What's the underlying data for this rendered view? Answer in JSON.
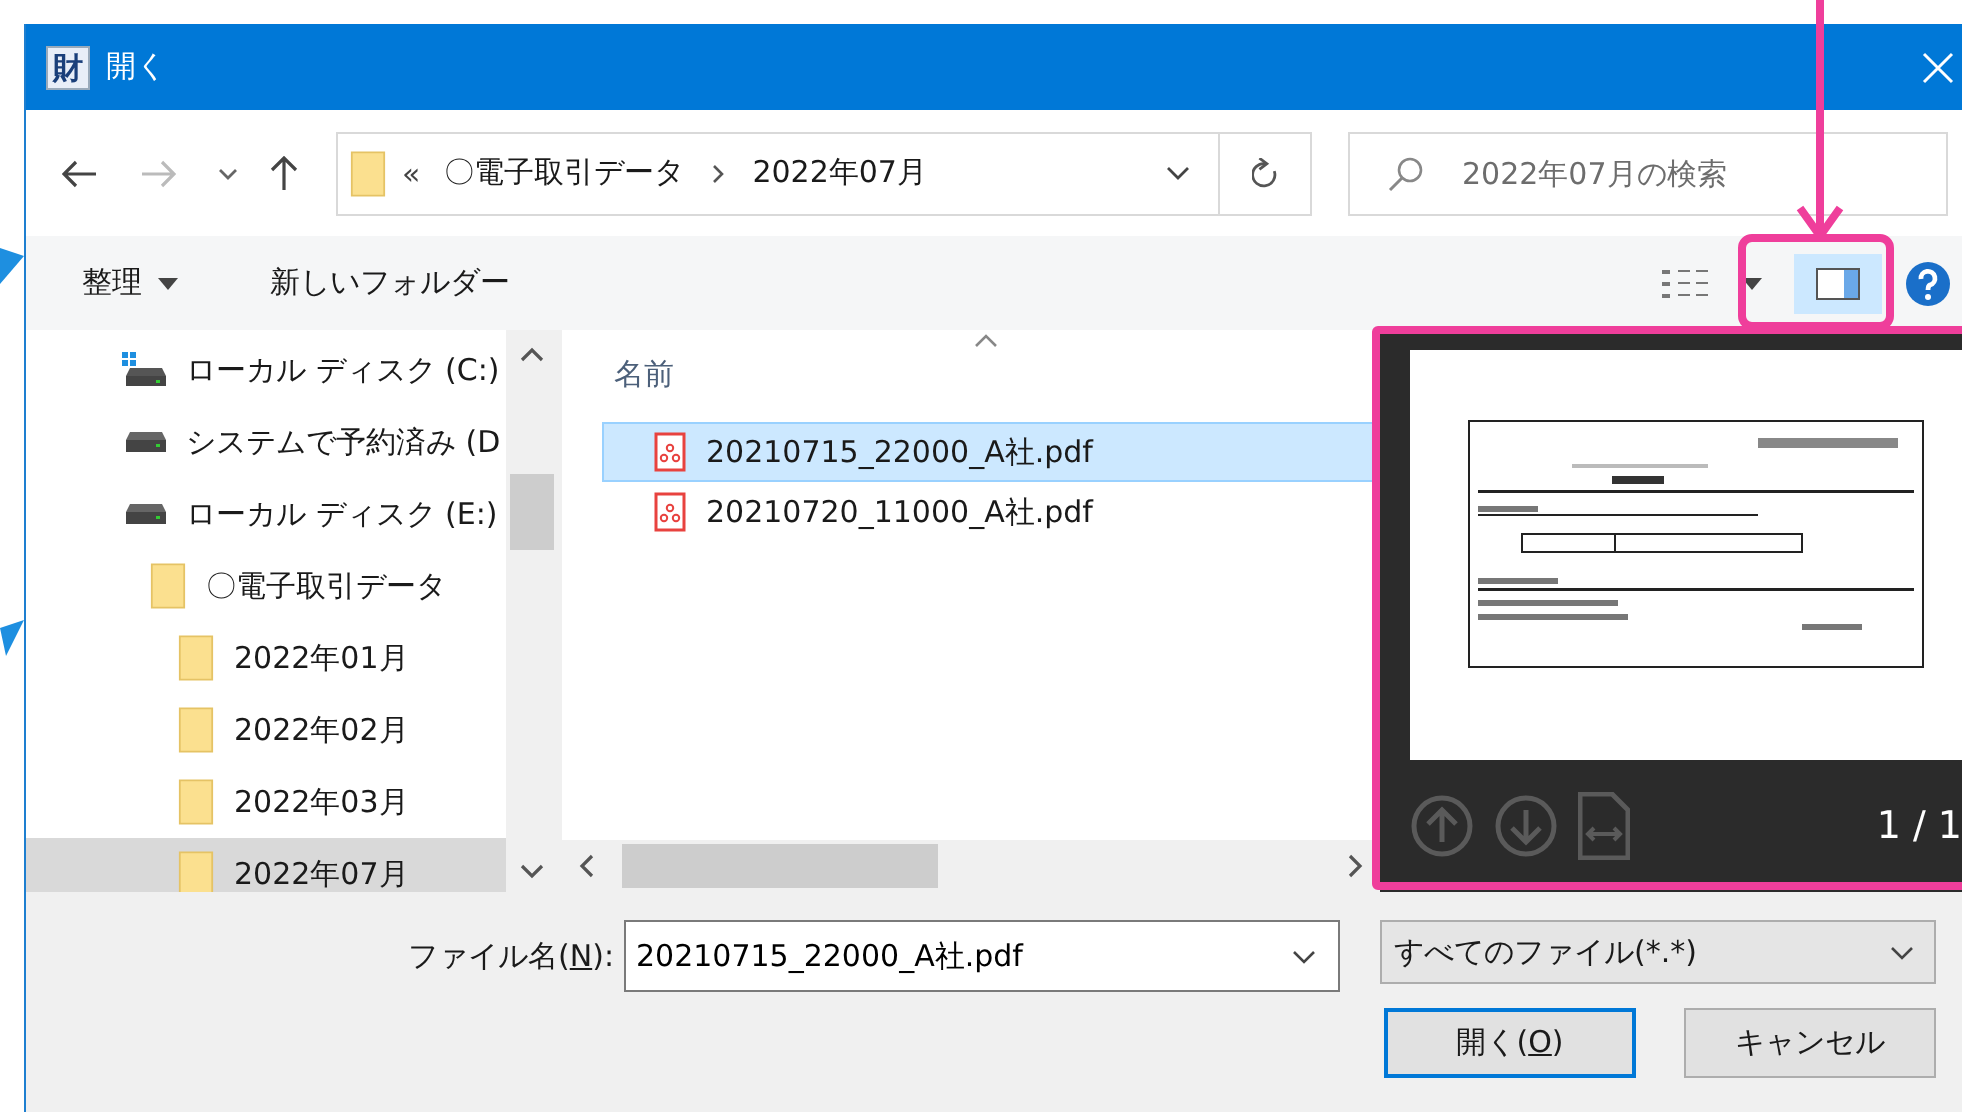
{
  "window": {
    "app_icon_text": "財",
    "title": "開く"
  },
  "address_bar": {
    "overflow": "«",
    "path": [
      {
        "label": "〇電子取引データ"
      },
      {
        "label": "2022年07月"
      }
    ]
  },
  "search": {
    "placeholder": "2022年07月の検索"
  },
  "toolbar": {
    "organize": "整理",
    "new_folder": "新しいフォルダー",
    "preview_pane_on": true
  },
  "tree": [
    {
      "kind": "drive_system",
      "label": "ローカル ディスク (C:)",
      "selected": false
    },
    {
      "kind": "drive",
      "label": "システムで予約済み (D",
      "selected": false
    },
    {
      "kind": "drive",
      "label": "ローカル ディスク (E:)",
      "selected": false,
      "children": [
        {
          "kind": "folder",
          "label": "〇電子取引データ",
          "selected": false,
          "children": [
            {
              "kind": "folder",
              "label": "2022年01月",
              "selected": false
            },
            {
              "kind": "folder",
              "label": "2022年02月",
              "selected": false
            },
            {
              "kind": "folder",
              "label": "2022年03月",
              "selected": false
            },
            {
              "kind": "folder",
              "label": "2022年07月",
              "selected": true
            }
          ]
        }
      ]
    }
  ],
  "file_list": {
    "columns": [
      "名前"
    ],
    "files": [
      {
        "name": "20210715_22000_A社.pdf",
        "selected": true
      },
      {
        "name": "20210720_11000_A社.pdf",
        "selected": false
      }
    ]
  },
  "preview": {
    "page_counter": "1 / 1"
  },
  "file_name": {
    "label": "ファイル名(N):",
    "access_key_underlined": true,
    "value": "20210715_22000_A社.pdf"
  },
  "file_type": {
    "value": "すべてのファイル(*.*)"
  },
  "buttons": [
    {
      "label": "開く(O)",
      "access_key_underlined": true,
      "default": true
    },
    {
      "label": "キャンセル",
      "default": false
    }
  ]
}
